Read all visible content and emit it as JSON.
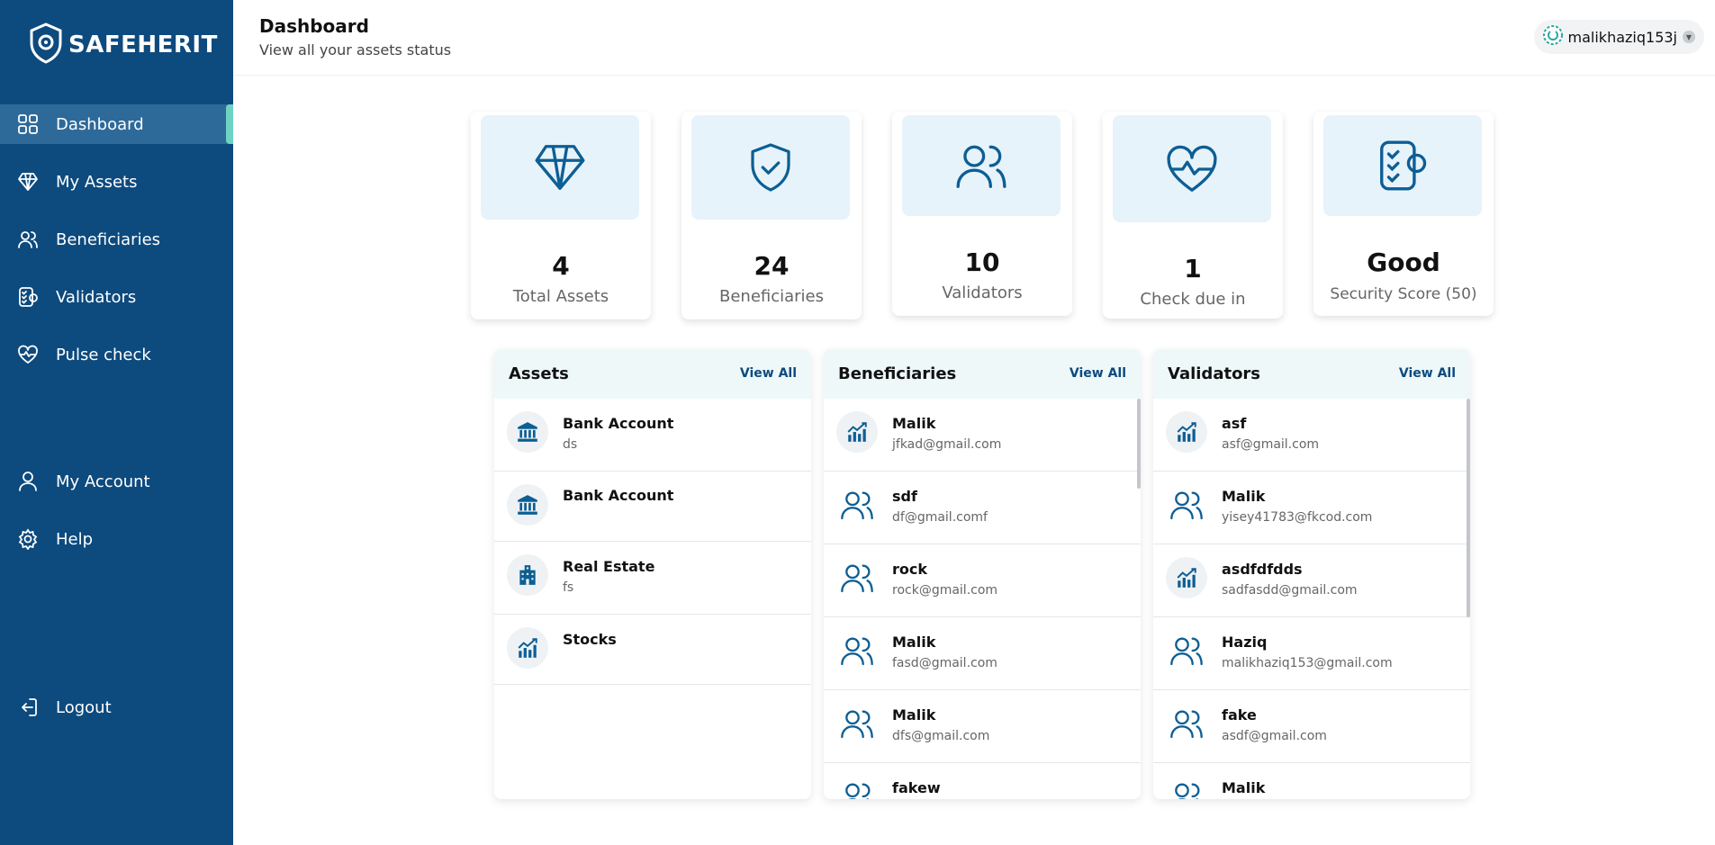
{
  "brand": {
    "name": "SAFEHERIT"
  },
  "sidebar": {
    "items": [
      {
        "label": "Dashboard",
        "icon": "grid-icon"
      },
      {
        "label": "My Assets",
        "icon": "diamond-icon"
      },
      {
        "label": "Beneficiaries",
        "icon": "users-icon"
      },
      {
        "label": "Validators",
        "icon": "checklist-icon"
      },
      {
        "label": "Pulse check",
        "icon": "heart-pulse-icon"
      },
      {
        "label": "My Account",
        "icon": "user-icon"
      },
      {
        "label": "Help",
        "icon": "gear-icon"
      },
      {
        "label": "Logout",
        "icon": "logout-icon"
      }
    ],
    "active": "Dashboard"
  },
  "header": {
    "title": "Dashboard",
    "subtitle": "View all your assets status",
    "user": {
      "name": "malikhaziq153j"
    }
  },
  "stats": [
    {
      "value": "4",
      "label": "Total Assets",
      "icon": "diamond-icon"
    },
    {
      "value": "24",
      "label": "Beneficiaries",
      "icon": "shield-check-icon"
    },
    {
      "value": "10",
      "label": "Validators",
      "icon": "users-icon"
    },
    {
      "value": "1",
      "label": "Check due in",
      "icon": "heart-pulse-icon"
    },
    {
      "value": "Good",
      "label": "Security Score (50)",
      "icon": "checklist-icon"
    }
  ],
  "panels": {
    "assets": {
      "title": "Assets",
      "link": "View All",
      "rows": [
        {
          "title": "Bank Account",
          "sub": "ds",
          "icon": "bank-icon"
        },
        {
          "title": "Bank Account",
          "sub": "",
          "icon": "bank-icon"
        },
        {
          "title": "Real Estate",
          "sub": "fs",
          "icon": "building-icon"
        },
        {
          "title": "Stocks",
          "sub": "",
          "icon": "chart-up-icon"
        }
      ]
    },
    "beneficiaries": {
      "title": "Beneficiaries",
      "link": "View All",
      "rows": [
        {
          "title": "Malik",
          "sub": "jfkad@gmail.com",
          "icon": "chart-up-icon"
        },
        {
          "title": "sdf",
          "sub": "df@gmail.comf",
          "icon": "users-icon"
        },
        {
          "title": "rock",
          "sub": "rock@gmail.com",
          "icon": "users-icon"
        },
        {
          "title": "Malik",
          "sub": "fasd@gmail.com",
          "icon": "users-icon"
        },
        {
          "title": "Malik",
          "sub": "dfs@gmail.com",
          "icon": "users-icon"
        },
        {
          "title": "fakew",
          "sub": "",
          "icon": "users-icon"
        }
      ]
    },
    "validators": {
      "title": "Validators",
      "link": "View All",
      "rows": [
        {
          "title": "asf",
          "sub": "asf@gmail.com",
          "icon": "chart-up-icon"
        },
        {
          "title": "Malik",
          "sub": "yisey41783@fkcod.com",
          "icon": "users-icon"
        },
        {
          "title": "asdfdfdds",
          "sub": "sadfasdd@gmail.com",
          "icon": "chart-up-icon"
        },
        {
          "title": "Haziq",
          "sub": "malikhaziq153@gmail.com",
          "icon": "users-icon"
        },
        {
          "title": "fake",
          "sub": "asdf@gmail.com",
          "icon": "users-icon"
        },
        {
          "title": "Malik",
          "sub": "",
          "icon": "users-icon"
        }
      ]
    }
  },
  "colors": {
    "sidebar": "#0d4a7e",
    "accent": "#0d5e94",
    "active_marker": "#6fd3c4"
  }
}
